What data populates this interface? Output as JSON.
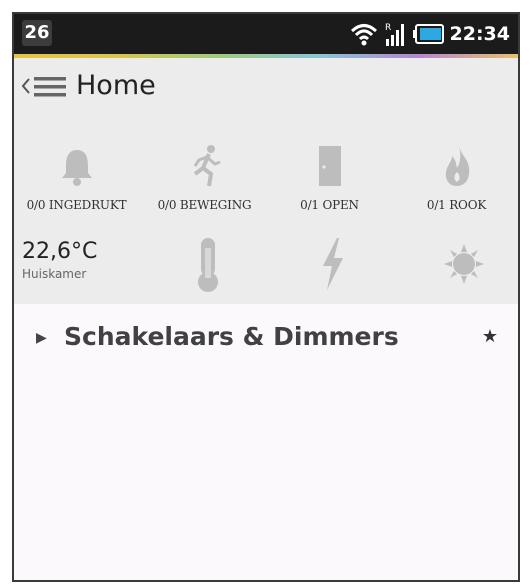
{
  "statusbar": {
    "notification_count": "26",
    "time": "22:34",
    "icons": [
      "wifi-icon",
      "signal-icon",
      "battery-icon"
    ]
  },
  "appbar": {
    "title": "Home",
    "icons": [
      "chevron-left-icon",
      "menu-icon"
    ]
  },
  "dashboard": {
    "tiles": [
      {
        "icon": "bell-icon",
        "label": "0/0 INGEDRUKT"
      },
      {
        "icon": "running-person-icon",
        "label": "0/0 BEWEGING"
      },
      {
        "icon": "door-icon",
        "label": "0/1 OPEN"
      },
      {
        "icon": "flame-icon",
        "label": "0/1 ROOK"
      }
    ],
    "temperature": {
      "value": "22,6°C",
      "room": "Huiskamer"
    },
    "sensors": [
      "thermometer-icon",
      "lightning-icon",
      "sun-icon"
    ]
  },
  "section": {
    "title": "Schakelaars & Dimmers",
    "expand_icon": "triangle-right-icon",
    "favorite_icon": "star-icon"
  },
  "colors": {
    "statusbar_bg": "#1b1b1b",
    "appbar_bg": "#ececec",
    "icon_gray": "#bdbdbd",
    "battery_accent": "#2fa8e0"
  }
}
